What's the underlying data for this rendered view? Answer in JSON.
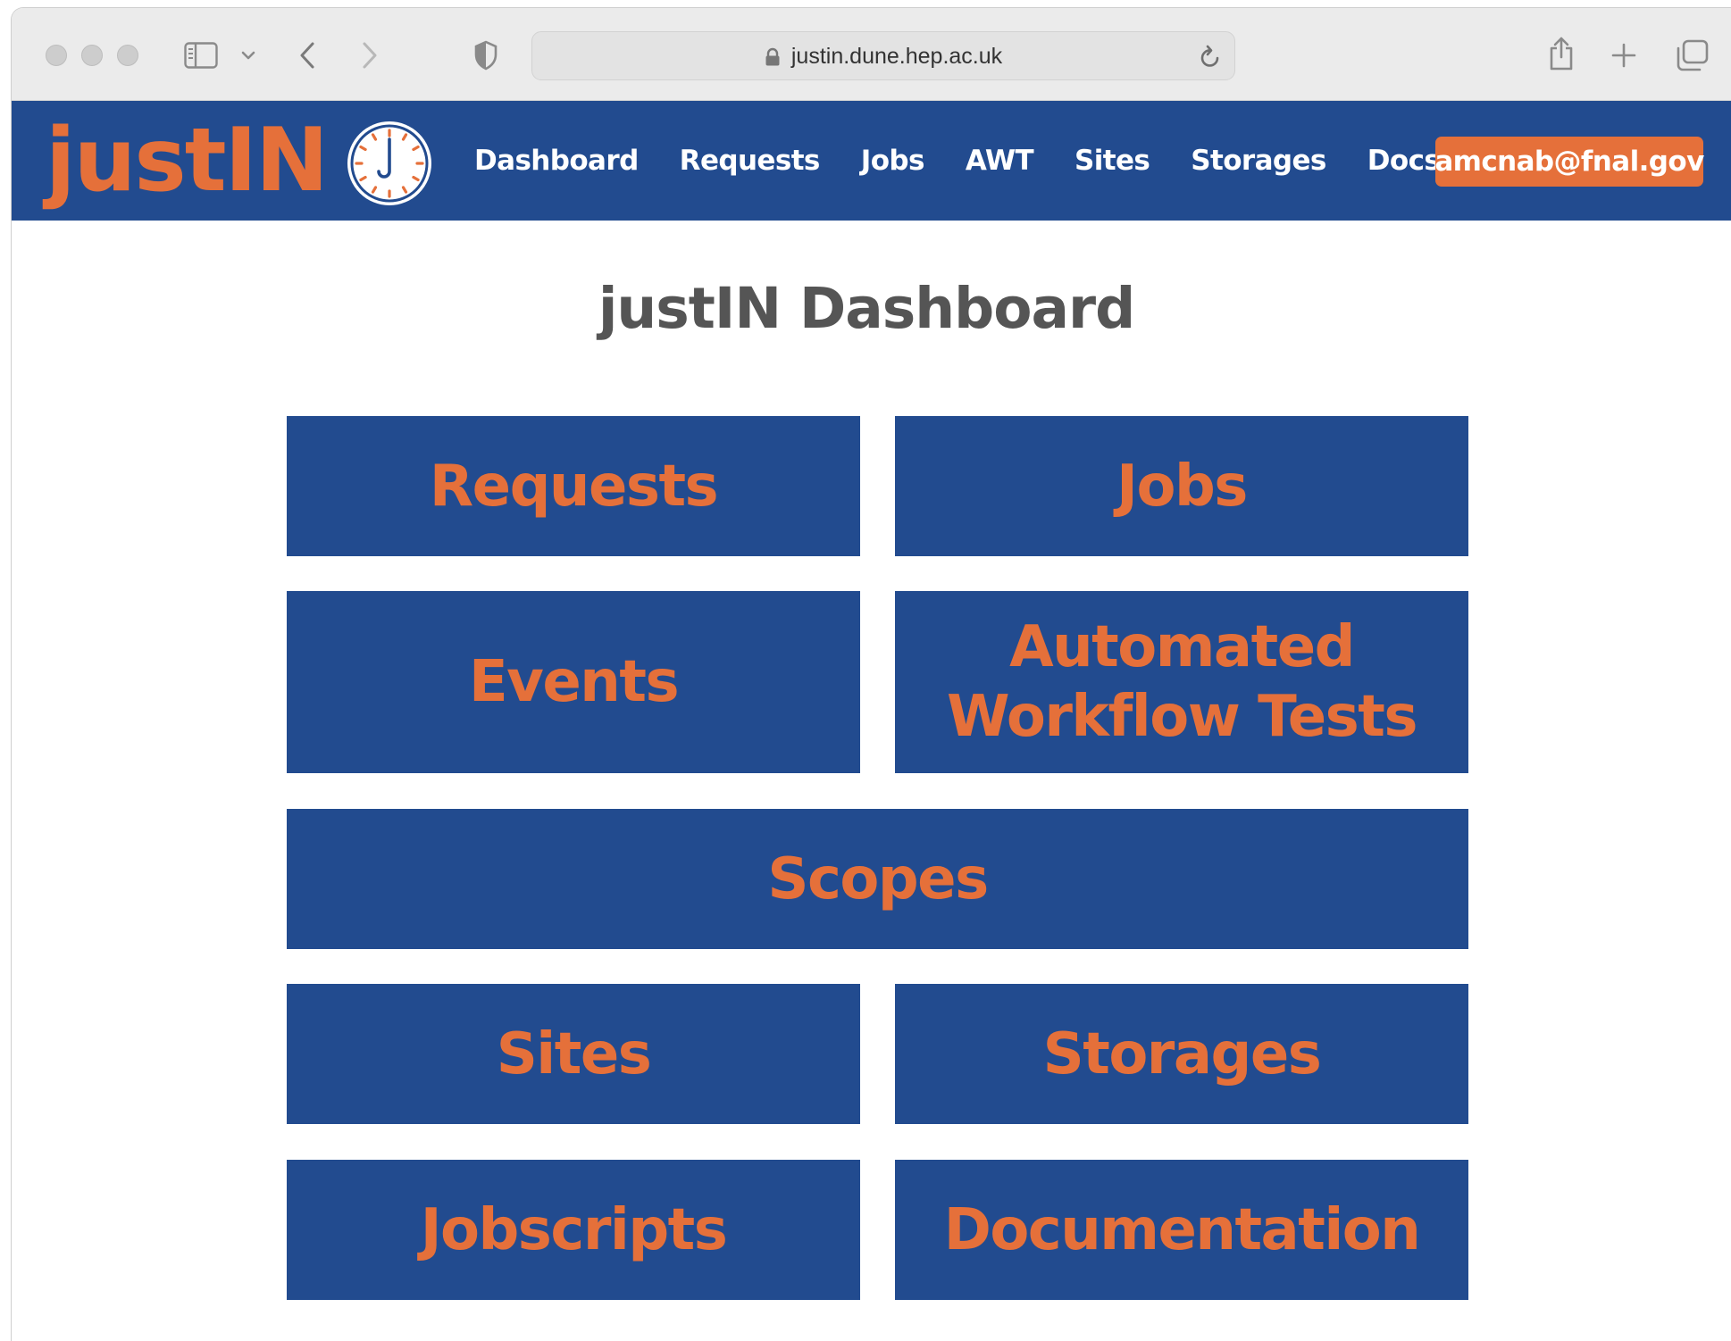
{
  "browser": {
    "url": "justin.dune.hep.ac.uk"
  },
  "header": {
    "logo": "justIN",
    "nav": [
      "Dashboard",
      "Requests",
      "Jobs",
      "AWT",
      "Sites",
      "Storages",
      "Docs"
    ],
    "user": "amcnab@fnal.gov"
  },
  "main": {
    "title": "justIN Dashboard",
    "tiles": [
      "Requests",
      "Jobs",
      "Events",
      "Automated\nWorkflow Tests",
      "Scopes",
      "Sites",
      "Storages",
      "Jobscripts",
      "Documentation"
    ]
  },
  "colors": {
    "brand_blue": "#224b8f",
    "brand_orange": "#e5703a",
    "title_gray": "#555555"
  }
}
